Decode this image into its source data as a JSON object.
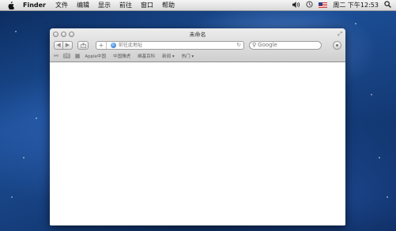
{
  "menubar": {
    "app_name": "Finder",
    "menus": [
      "文件",
      "编辑",
      "显示",
      "前往",
      "窗口",
      "帮助"
    ],
    "status_icons": [
      "volume-icon",
      "time-machine-icon",
      "us-flag-input-icon",
      "spotlight-icon"
    ],
    "clock": "周二 下午12:53"
  },
  "window": {
    "title": "未命名",
    "address": {
      "placeholder": "前往此地址",
      "value": ""
    },
    "search": {
      "placeholder": "Google",
      "value": ""
    },
    "bookmarks": [
      "Apple中国",
      "中国雅虎",
      "维基百科",
      "新闻 ▾",
      "热门 ▾"
    ]
  },
  "colors": {
    "desktop": "#1c4f97",
    "menubar": "#e6e6e6",
    "globe": "#1a62c4"
  }
}
